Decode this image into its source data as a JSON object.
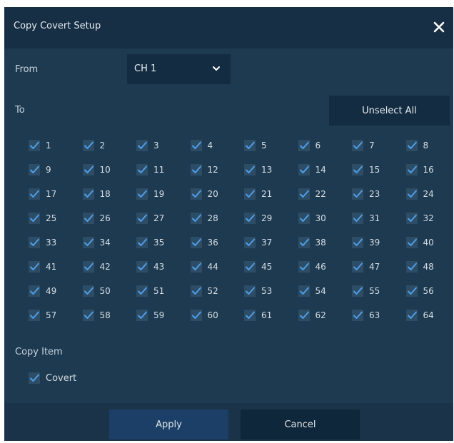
{
  "dialog": {
    "title": "Copy Covert Setup",
    "close_icon": "close-icon"
  },
  "from": {
    "label": "From",
    "selected": "CH 1"
  },
  "to": {
    "label": "To",
    "unselect_all_label": "Unselect All",
    "channels": [
      {
        "label": "1",
        "checked": true
      },
      {
        "label": "2",
        "checked": true
      },
      {
        "label": "3",
        "checked": true
      },
      {
        "label": "4",
        "checked": true
      },
      {
        "label": "5",
        "checked": true
      },
      {
        "label": "6",
        "checked": true
      },
      {
        "label": "7",
        "checked": true
      },
      {
        "label": "8",
        "checked": true
      },
      {
        "label": "9",
        "checked": true
      },
      {
        "label": "10",
        "checked": true
      },
      {
        "label": "11",
        "checked": true
      },
      {
        "label": "12",
        "checked": true
      },
      {
        "label": "13",
        "checked": true
      },
      {
        "label": "14",
        "checked": true
      },
      {
        "label": "15",
        "checked": true
      },
      {
        "label": "16",
        "checked": true
      },
      {
        "label": "17",
        "checked": true
      },
      {
        "label": "18",
        "checked": true
      },
      {
        "label": "19",
        "checked": true
      },
      {
        "label": "20",
        "checked": true
      },
      {
        "label": "21",
        "checked": true
      },
      {
        "label": "22",
        "checked": true
      },
      {
        "label": "23",
        "checked": true
      },
      {
        "label": "24",
        "checked": true
      },
      {
        "label": "25",
        "checked": true
      },
      {
        "label": "26",
        "checked": true
      },
      {
        "label": "27",
        "checked": true
      },
      {
        "label": "28",
        "checked": true
      },
      {
        "label": "29",
        "checked": true
      },
      {
        "label": "30",
        "checked": true
      },
      {
        "label": "31",
        "checked": true
      },
      {
        "label": "32",
        "checked": true
      },
      {
        "label": "33",
        "checked": true
      },
      {
        "label": "34",
        "checked": true
      },
      {
        "label": "35",
        "checked": true
      },
      {
        "label": "36",
        "checked": true
      },
      {
        "label": "37",
        "checked": true
      },
      {
        "label": "38",
        "checked": true
      },
      {
        "label": "39",
        "checked": true
      },
      {
        "label": "40",
        "checked": true
      },
      {
        "label": "41",
        "checked": true
      },
      {
        "label": "42",
        "checked": true
      },
      {
        "label": "43",
        "checked": true
      },
      {
        "label": "44",
        "checked": true
      },
      {
        "label": "45",
        "checked": true
      },
      {
        "label": "46",
        "checked": true
      },
      {
        "label": "47",
        "checked": true
      },
      {
        "label": "48",
        "checked": true
      },
      {
        "label": "49",
        "checked": true
      },
      {
        "label": "50",
        "checked": true
      },
      {
        "label": "51",
        "checked": true
      },
      {
        "label": "52",
        "checked": true
      },
      {
        "label": "53",
        "checked": true
      },
      {
        "label": "54",
        "checked": true
      },
      {
        "label": "55",
        "checked": true
      },
      {
        "label": "56",
        "checked": true
      },
      {
        "label": "57",
        "checked": true
      },
      {
        "label": "58",
        "checked": true
      },
      {
        "label": "59",
        "checked": true
      },
      {
        "label": "60",
        "checked": true
      },
      {
        "label": "61",
        "checked": true
      },
      {
        "label": "62",
        "checked": true
      },
      {
        "label": "63",
        "checked": true
      },
      {
        "label": "64",
        "checked": true
      }
    ]
  },
  "copy_item": {
    "label": "Copy Item",
    "items": [
      {
        "label": "Covert",
        "checked": true
      }
    ]
  },
  "footer": {
    "apply_label": "Apply",
    "cancel_label": "Cancel"
  },
  "colors": {
    "dialog_bg": "#1e3a50",
    "titlebar_bg": "#172f44",
    "control_bg": "#142c41",
    "checkbox_bg": "#2d4d66",
    "check_mark": "#4f9de8",
    "apply_bg": "#1b3f66"
  }
}
